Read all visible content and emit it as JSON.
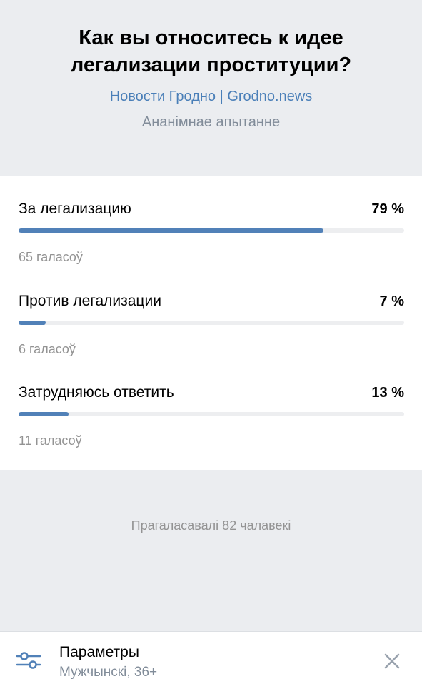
{
  "header": {
    "title": "Как вы относитесь к идее легализации проституции?",
    "source": "Новости Гродно | Grodno.news",
    "poll_type": "Ананімнае апытанне"
  },
  "answers": [
    {
      "label": "За легализацию",
      "percent_text": "79 %",
      "percent": 79,
      "votes": "65 галасоў"
    },
    {
      "label": "Против легализации",
      "percent_text": "7 %",
      "percent": 7,
      "votes": "6 галасоў"
    },
    {
      "label": "Затрудняюсь ответить",
      "percent_text": "13 %",
      "percent": 13,
      "votes": "11 галасоў"
    }
  ],
  "total_text": "Прагаласавалі 82 чалавекі",
  "footer": {
    "filter_icon": "sliders-icon",
    "title": "Параметры",
    "subtitle": "Мужчынскі, 36+",
    "close_icon": "close-icon"
  },
  "colors": {
    "accent": "#5181b8",
    "link": "#4a7fb8",
    "muted": "#939393",
    "background": "#ebedf0"
  }
}
